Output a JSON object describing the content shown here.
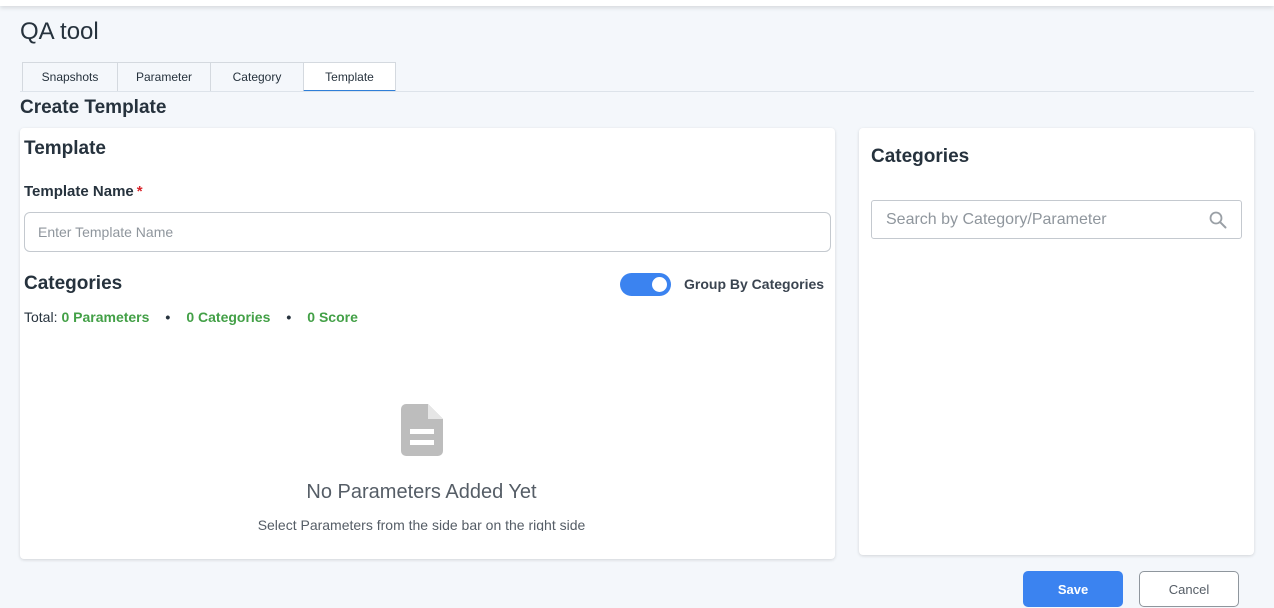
{
  "app": {
    "title": "QA tool"
  },
  "tabs": [
    {
      "label": "Snapshots"
    },
    {
      "label": "Parameter"
    },
    {
      "label": "Category"
    },
    {
      "label": "Template",
      "active": true
    }
  ],
  "page": {
    "heading": "Create Template"
  },
  "template_card": {
    "title": "Template",
    "name_label": "Template Name",
    "required_mark": "*",
    "name_value": "",
    "name_placeholder": "Enter Template Name",
    "categories_heading": "Categories",
    "group_toggle": {
      "label": "Group By Categories",
      "on": true,
      "color": "#3b83f0"
    },
    "totals": {
      "label": "Total:",
      "parameters": "0 Parameters",
      "categories": "0 Categories",
      "score": "0 Score",
      "separator": "•",
      "value_color": "#43a047"
    },
    "empty_state": {
      "icon": "document-icon",
      "title": "No Parameters Added Yet",
      "subtitle": "Select Parameters from the side bar on the right side"
    }
  },
  "categories_panel": {
    "title": "Categories",
    "search_placeholder": "Search by Category/Parameter",
    "search_value": "",
    "search_icon": "search-icon"
  },
  "actions": {
    "save_label": "Save",
    "cancel_label": "Cancel",
    "primary_color": "#3b83f0"
  }
}
